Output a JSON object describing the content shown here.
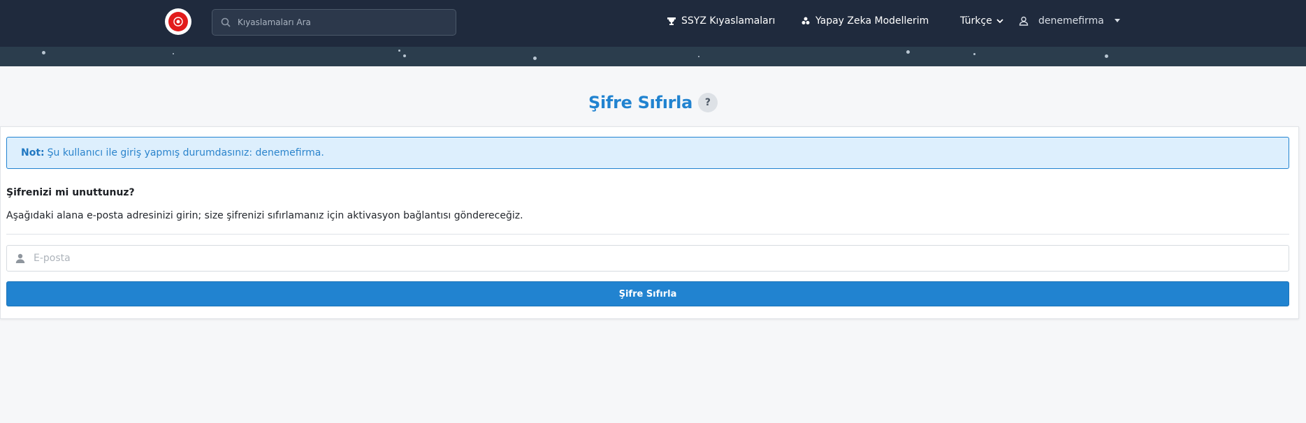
{
  "colors": {
    "topbar": "#1f2a3d",
    "accent": "#2183d0",
    "note_bg": "#ddeffd"
  },
  "header": {
    "search_placeholder": "Kıyaslamaları Ara",
    "nav": {
      "benchmarks": "SSYZ Kıyaslamaları",
      "models": "Yapay Zeka Modellerim",
      "language": "Türkçe",
      "user": "denemefirma"
    },
    "icons": {
      "logo": "logo-emblem",
      "search": "search-icon",
      "benchmarks": "trophy-icon",
      "models": "models-icon",
      "language": "chevron-down-icon",
      "user": "user-icon",
      "user_caret": "caret-down-icon"
    }
  },
  "page": {
    "title": "Şifre Sıfırla",
    "help": "?",
    "note_label": "Not:",
    "note_text": "Şu kullanıcı ile giriş yapmış durumdasınız: denemefirma.",
    "forgot_heading": "Şifrenizi mi unuttunuz?",
    "description": "Aşağıdaki alana e-posta adresinizi girin; size şifrenizi sıfırlamanız için aktivasyon bağlantısı göndereceğiz.",
    "email_placeholder": "E-posta",
    "submit_label": "Şifre Sıfırla"
  }
}
